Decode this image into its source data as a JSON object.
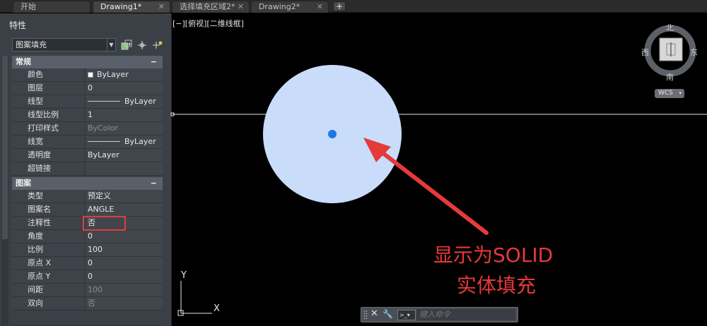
{
  "tabs": [
    {
      "label": "开始",
      "active": false
    },
    {
      "label": "Drawing1*",
      "active": true
    },
    {
      "label": "选择填充区域2*",
      "active": false
    },
    {
      "label": "Drawing2*",
      "active": false
    }
  ],
  "properties": {
    "title": "特性",
    "selector_value": "图案填充",
    "sections": {
      "general": {
        "title": "常规",
        "rows": [
          {
            "key": "颜色",
            "value": "ByLayer"
          },
          {
            "key": "图层",
            "value": "0"
          },
          {
            "key": "线型",
            "value": "ByLayer"
          },
          {
            "key": "线型比例",
            "value": "1"
          },
          {
            "key": "打印样式",
            "value": "ByColor"
          },
          {
            "key": "线宽",
            "value": "ByLayer"
          },
          {
            "key": "透明度",
            "value": "ByLayer"
          },
          {
            "key": "超链接",
            "value": ""
          }
        ]
      },
      "pattern": {
        "title": "图案",
        "rows": [
          {
            "key": "类型",
            "value": "预定义"
          },
          {
            "key": "图案名",
            "value": "ANGLE"
          },
          {
            "key": "注释性",
            "value": "否"
          },
          {
            "key": "角度",
            "value": "0"
          },
          {
            "key": "比例",
            "value": "100"
          },
          {
            "key": "原点 X",
            "value": "0"
          },
          {
            "key": "原点 Y",
            "value": "0"
          },
          {
            "key": "间距",
            "value": "100"
          },
          {
            "key": "双向",
            "value": "否"
          }
        ]
      }
    }
  },
  "viewport": {
    "label": "[−][俯视][二维线框]",
    "annotation_line1": "显示为SOLID",
    "annotation_line2": "实体填充",
    "ucs_x": "X",
    "ucs_y": "Y"
  },
  "viewcube": {
    "north": "北",
    "south": "南",
    "east": "东",
    "west": "西",
    "wcs": "WCS"
  },
  "command": {
    "placeholder": "键入命令"
  },
  "colors": {
    "fill": "#c9dcfa",
    "center_point": "#1e78e6",
    "annotation": "#e53a3a"
  }
}
